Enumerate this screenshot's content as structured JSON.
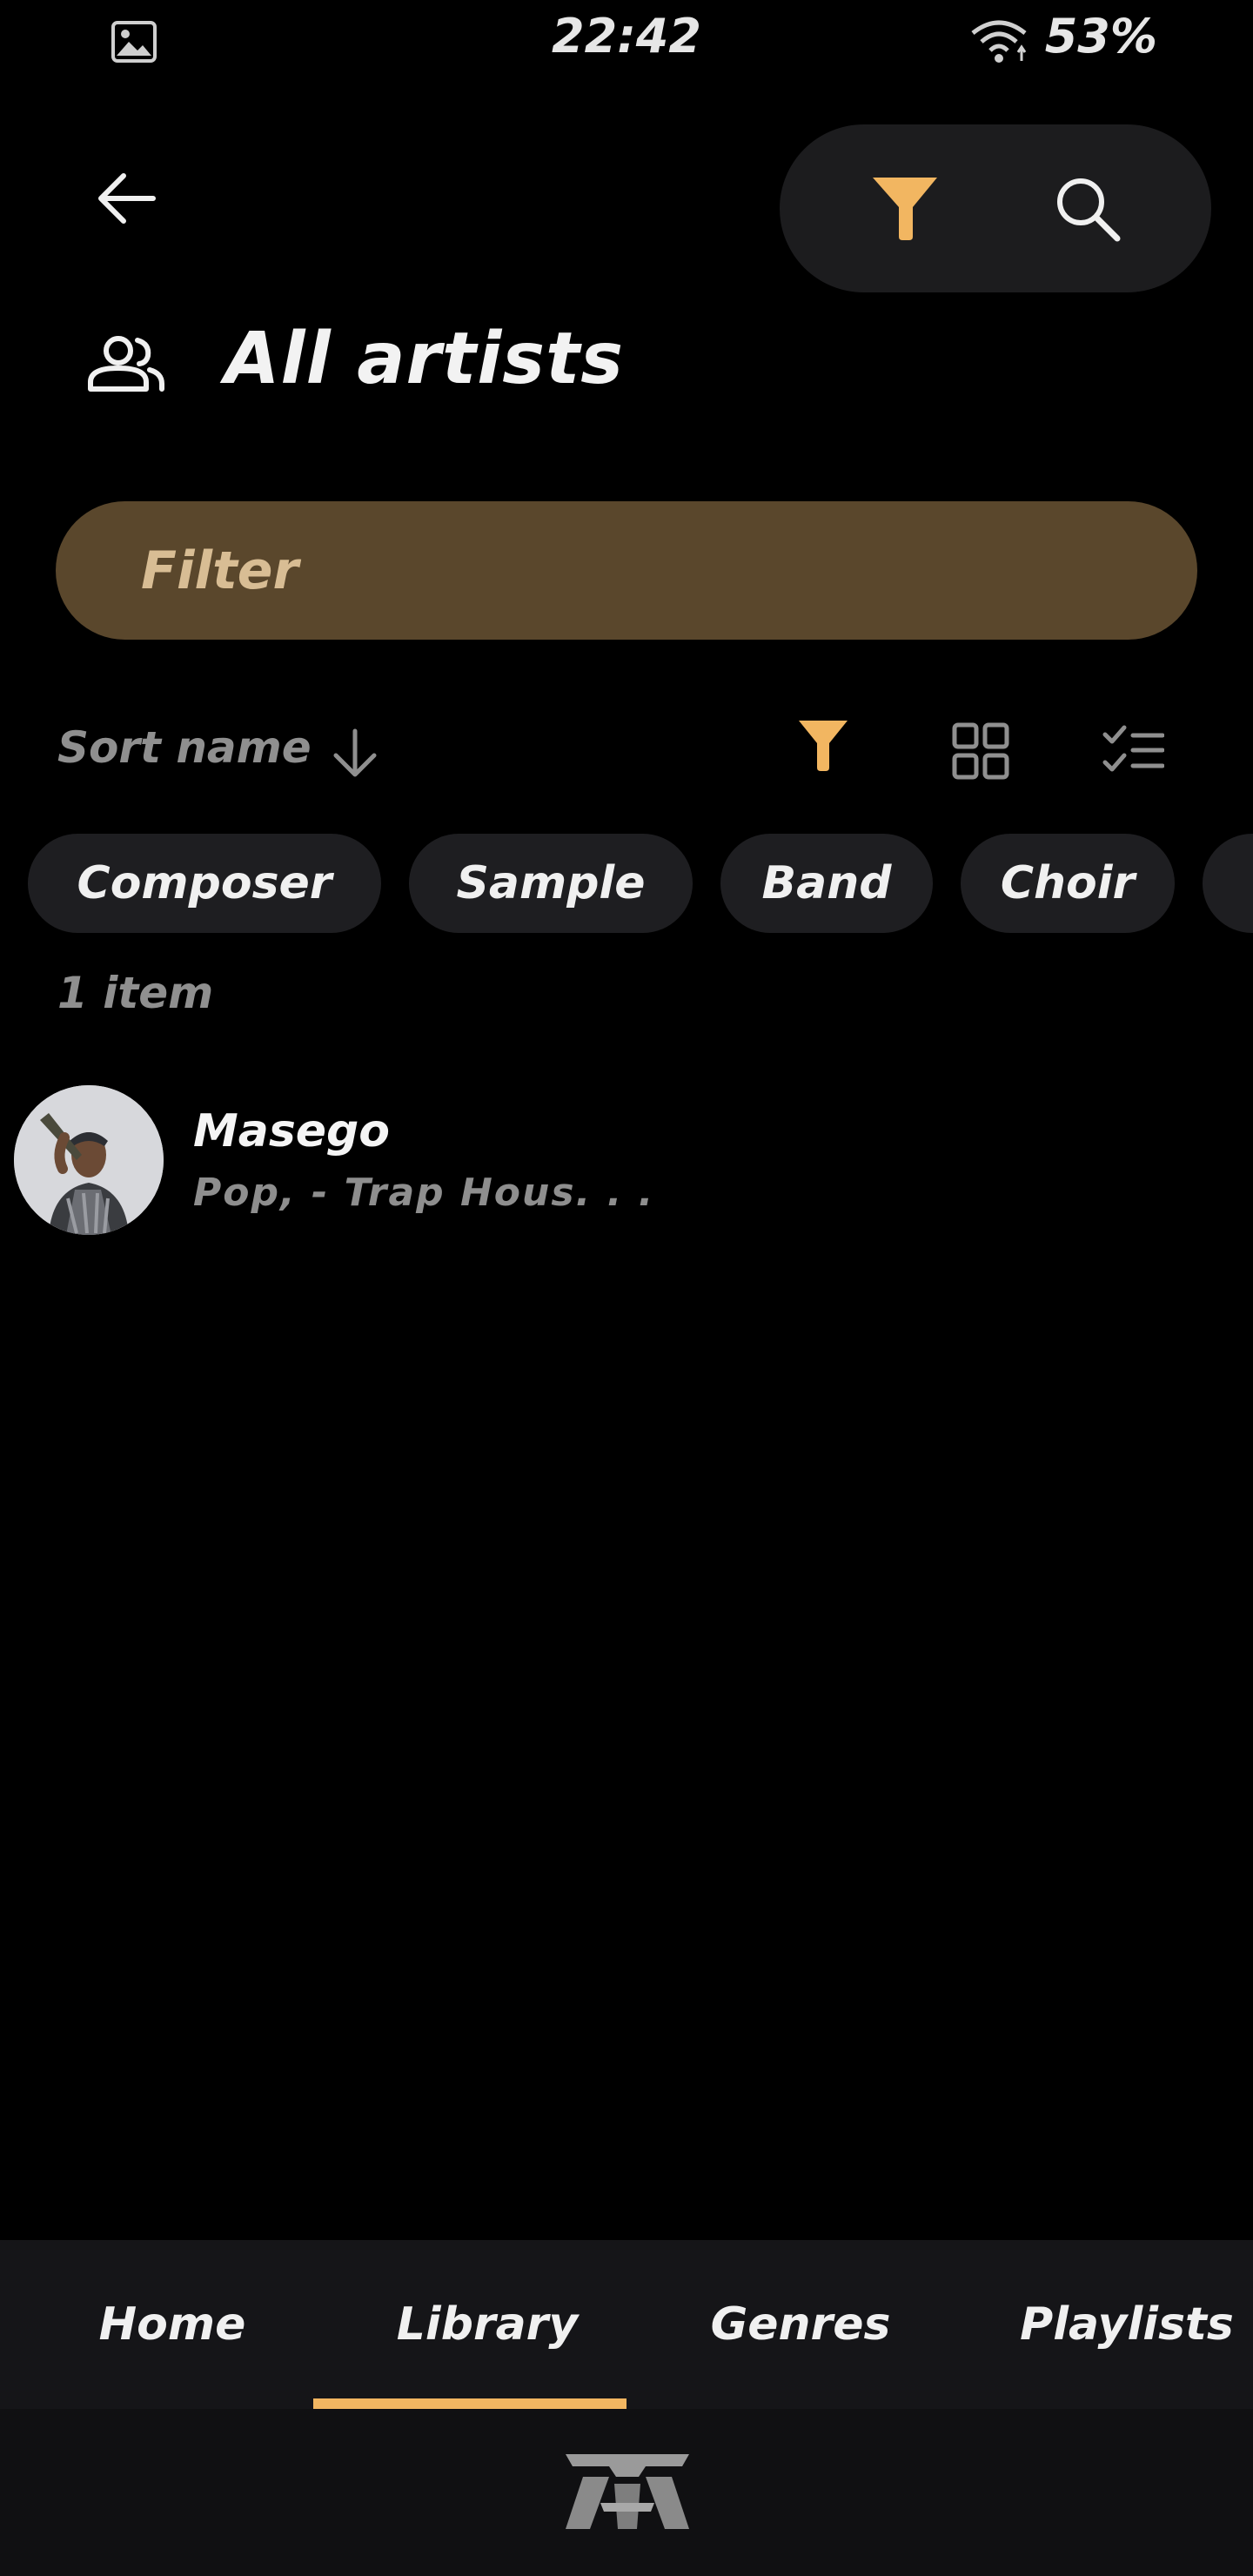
{
  "status_bar": {
    "time": "22:42",
    "battery": "53%",
    "icons": [
      "image-icon",
      "wifi-icon",
      "battery-icon"
    ]
  },
  "header": {
    "back_icon": "arrow-left-icon",
    "filter_icon": "filter-icon",
    "search_icon": "search-icon",
    "accent_color": "#F2B661"
  },
  "page": {
    "title": "All artists",
    "title_icon": "people-icon"
  },
  "filter": {
    "placeholder": "Filter",
    "value": ""
  },
  "sort": {
    "label": "Sort name",
    "direction_icon": "arrow-down-icon",
    "tools": [
      "filter-icon",
      "grid-view-icon",
      "checklist-icon"
    ]
  },
  "chips": [
    {
      "label": "Composer"
    },
    {
      "label": "Sample"
    },
    {
      "label": "Band"
    },
    {
      "label": "Choir"
    }
  ],
  "list": {
    "count_label": "1 item",
    "items": [
      {
        "name": "Masego",
        "genres": "Pop, - Trap Hous. . ."
      }
    ]
  },
  "bottom_nav": {
    "tabs": [
      {
        "label": "Home"
      },
      {
        "label": "Library"
      },
      {
        "label": "Genres"
      },
      {
        "label": "Playlists"
      }
    ],
    "active_tab": "Library"
  },
  "footer": {
    "logo_icon": "app-logo-icon"
  }
}
